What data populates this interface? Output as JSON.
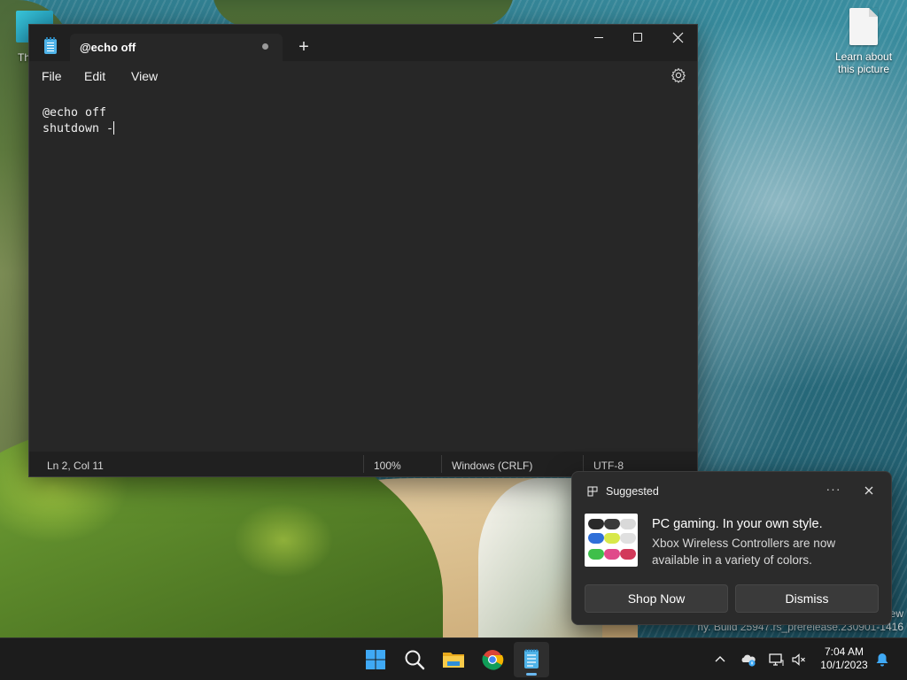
{
  "desktop": {
    "left_icon_label": "Th",
    "right_icon_label": "Learn about this picture",
    "watermark_line1": "ew",
    "watermark_line2": "ny. Build 25947.rs_prerelease.230901-1416"
  },
  "notepad": {
    "tab_title": "@echo off",
    "new_tab_symbol": "+",
    "menu": {
      "file": "File",
      "edit": "Edit",
      "view": "View"
    },
    "content_lines": [
      "@echo off",
      "shutdown -"
    ],
    "status": {
      "position": "Ln 2, Col 11",
      "zoom": "100%",
      "line_endings": "Windows (CRLF)",
      "encoding": "UTF-8"
    },
    "icons": {
      "app": "notepad-icon",
      "settings": "gear-icon",
      "minimize": "minimize-icon",
      "maximize": "maximize-icon",
      "close": "close-icon"
    }
  },
  "notification": {
    "header": "Suggested",
    "more_symbol": "···",
    "title": "PC gaming. In your own style.",
    "body": "Xbox Wireless Controllers are now available in a variety of colors.",
    "buttons": {
      "primary": "Shop Now",
      "secondary": "Dismiss"
    }
  },
  "taskbar": {
    "apps": [
      "start",
      "search",
      "file-explorer",
      "chrome",
      "notepad"
    ],
    "clock": {
      "time": "7:04 AM",
      "date": "10/1/2023"
    }
  },
  "colors": {
    "window_bg": "#272727",
    "titlebar_bg": "#202020",
    "taskbar_bg": "#1c1c1c",
    "accent": "#4fb3e8"
  }
}
